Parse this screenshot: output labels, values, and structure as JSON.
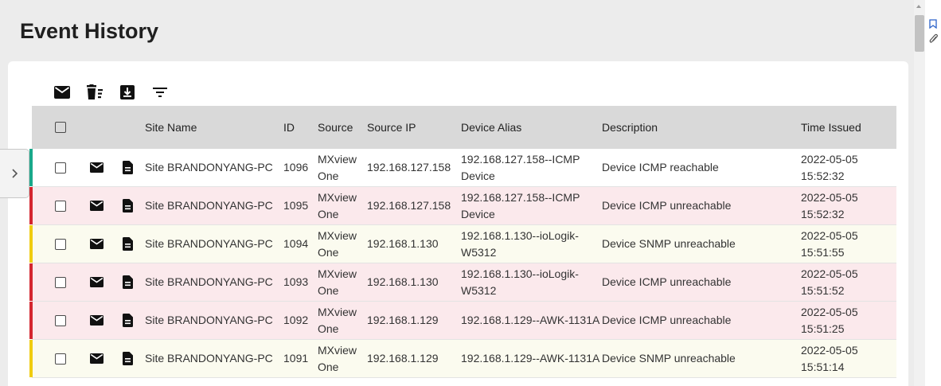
{
  "page": {
    "title": "Event History"
  },
  "toolbar": {
    "icons": [
      "mail-icon",
      "clear-list-icon",
      "download-icon",
      "filter-icon"
    ]
  },
  "table": {
    "headers": {
      "site_name": "Site Name",
      "id": "ID",
      "source": "Source",
      "source_ip": "Source IP",
      "device_alias": "Device Alias",
      "description": "Description",
      "time_issued": "Time Issued"
    },
    "rows": [
      {
        "severity_color": "#1aa88a",
        "bg": "#ffffff",
        "site": "Site BRANDONYANG-PC",
        "id": "1096",
        "source": [
          "MXview",
          "One"
        ],
        "source_ip": "192.168.127.158",
        "alias": [
          "192.168.127.158--ICMP",
          "Device"
        ],
        "description": "Device ICMP reachable",
        "time": [
          "2022-05-05",
          "15:52:32"
        ]
      },
      {
        "severity_color": "#d4262f",
        "bg": "#fbe9ec",
        "site": "Site BRANDONYANG-PC",
        "id": "1095",
        "source": [
          "MXview",
          "One"
        ],
        "source_ip": "192.168.127.158",
        "alias": [
          "192.168.127.158--ICMP",
          "Device"
        ],
        "description": "Device ICMP unreachable",
        "time": [
          "2022-05-05",
          "15:52:32"
        ]
      },
      {
        "severity_color": "#f0cc10",
        "bg": "#fbfbef",
        "site": "Site BRANDONYANG-PC",
        "id": "1094",
        "source": [
          "MXview",
          "One"
        ],
        "source_ip": "192.168.1.130",
        "alias": [
          "192.168.1.130--ioLogik-",
          "W5312"
        ],
        "description": "Device SNMP unreachable",
        "time": [
          "2022-05-05",
          "15:51:55"
        ]
      },
      {
        "severity_color": "#d4262f",
        "bg": "#fbe9ec",
        "site": "Site BRANDONYANG-PC",
        "id": "1093",
        "source": [
          "MXview",
          "One"
        ],
        "source_ip": "192.168.1.130",
        "alias": [
          "192.168.1.130--ioLogik-",
          "W5312"
        ],
        "description": "Device ICMP unreachable",
        "time": [
          "2022-05-05",
          "15:51:52"
        ]
      },
      {
        "severity_color": "#d4262f",
        "bg": "#fbe9ec",
        "site": "Site BRANDONYANG-PC",
        "id": "1092",
        "source": [
          "MXview",
          "One"
        ],
        "source_ip": "192.168.1.129",
        "alias": [
          "192.168.1.129--AWK-1131A"
        ],
        "description": "Device ICMP unreachable",
        "time": [
          "2022-05-05",
          "15:51:25"
        ]
      },
      {
        "severity_color": "#f0cc10",
        "bg": "#fbfbef",
        "site": "Site BRANDONYANG-PC",
        "id": "1091",
        "source": [
          "MXview",
          "One"
        ],
        "source_ip": "192.168.1.129",
        "alias": [
          "192.168.1.129--AWK-1131A"
        ],
        "description": "Device SNMP unreachable",
        "time": [
          "2022-05-05",
          "15:51:14"
        ]
      }
    ]
  },
  "side_toggle": {
    "icon": "chevron-right-icon"
  },
  "right_strip": {
    "icons": [
      "bookmark-icon",
      "attachment-icon"
    ]
  }
}
